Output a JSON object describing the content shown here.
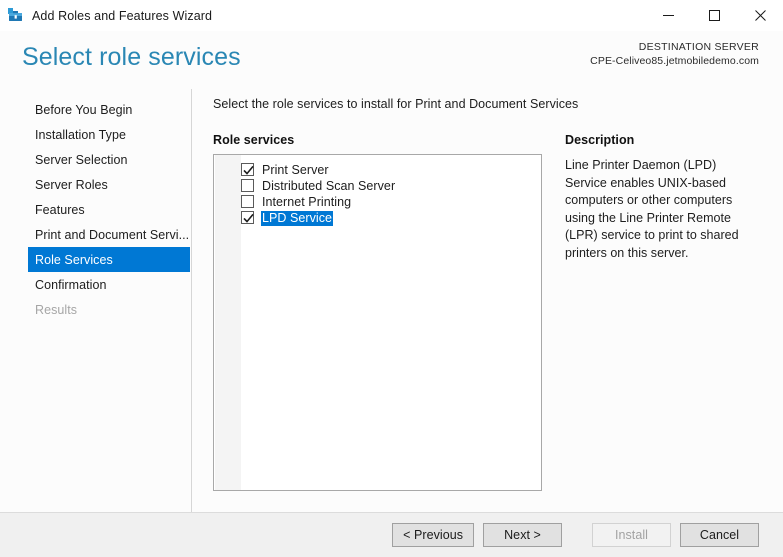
{
  "window": {
    "title": "Add Roles and Features Wizard",
    "icon": "wizard-toolbox-icon",
    "controls": {
      "minimize": "Minimize",
      "maximize": "Maximize",
      "close": "Close"
    }
  },
  "header": {
    "page_title": "Select role services",
    "destination_label": "DESTINATION SERVER",
    "destination_server": "CPE-Celiveo85.jetmobiledemo.com",
    "title_color": "#2a87b4"
  },
  "sidebar": {
    "items": [
      {
        "label": "Before You Begin",
        "state": "normal"
      },
      {
        "label": "Installation Type",
        "state": "normal"
      },
      {
        "label": "Server Selection",
        "state": "normal"
      },
      {
        "label": "Server Roles",
        "state": "normal"
      },
      {
        "label": "Features",
        "state": "normal"
      },
      {
        "label": "Print and Document Servi...",
        "state": "normal"
      },
      {
        "label": "Role Services",
        "state": "selected"
      },
      {
        "label": "Confirmation",
        "state": "normal"
      },
      {
        "label": "Results",
        "state": "disabled"
      }
    ],
    "selected_color": "#0078d4"
  },
  "main": {
    "instruction": "Select the role services to install for Print and Document Services",
    "role_services_label": "Role services",
    "role_services": [
      {
        "label": "Print Server",
        "checked": true,
        "selected": false
      },
      {
        "label": "Distributed Scan Server",
        "checked": false,
        "selected": false
      },
      {
        "label": "Internet Printing",
        "checked": false,
        "selected": false
      },
      {
        "label": "LPD Service",
        "checked": true,
        "selected": true
      }
    ],
    "description_label": "Description",
    "description_text": "Line Printer Daemon (LPD) Service enables UNIX-based computers or other computers using the Line Printer Remote (LPR) service to print to shared printers on this server."
  },
  "footer": {
    "previous": "< Previous",
    "next": "Next >",
    "install": "Install",
    "cancel": "Cancel",
    "install_enabled": false
  }
}
